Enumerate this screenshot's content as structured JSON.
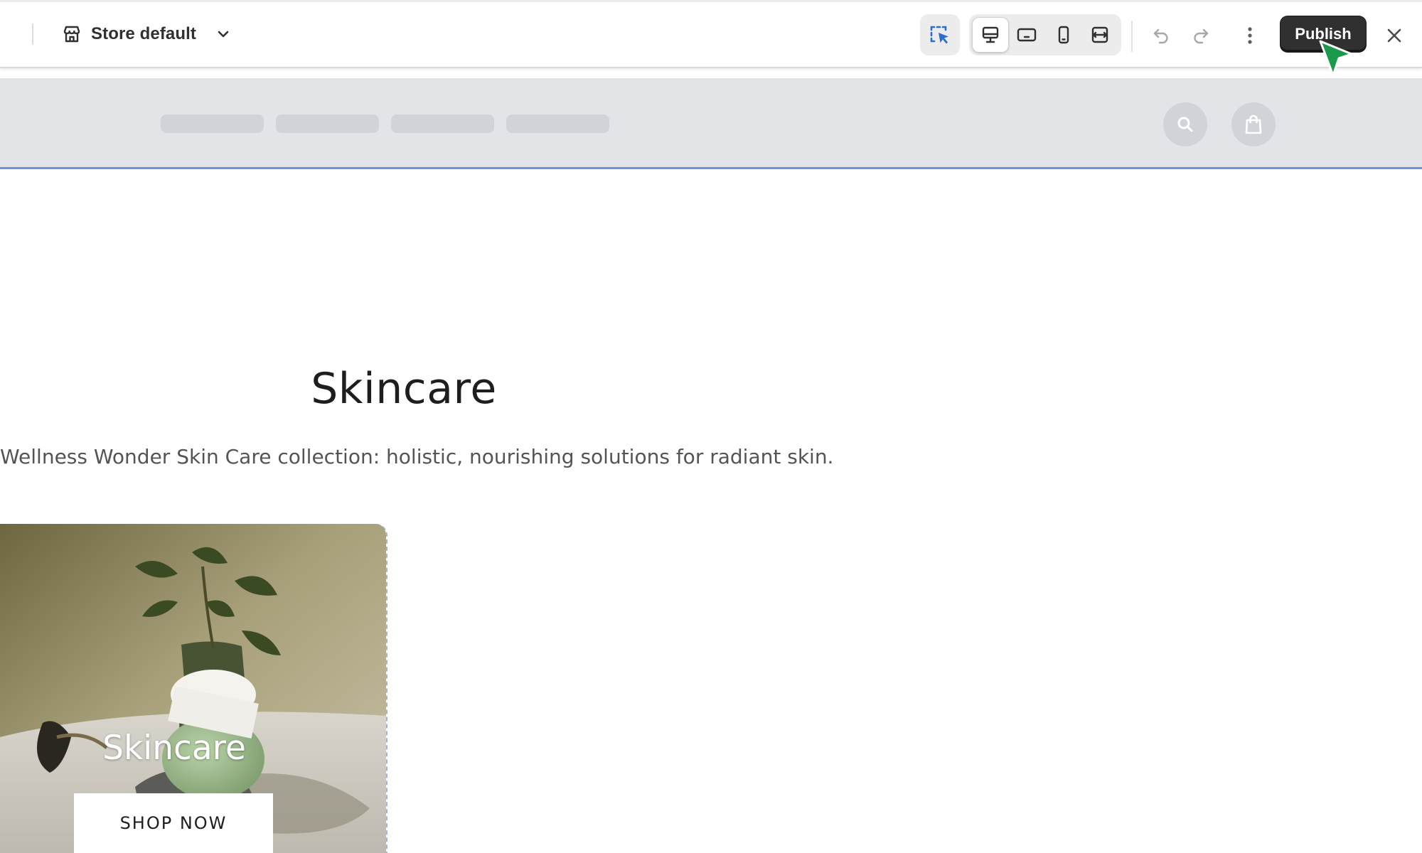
{
  "toolbar": {
    "store_selector": {
      "label": "Store default"
    },
    "select_tool": {
      "icon": "select-cursor-icon",
      "accent": "#2c6ecb"
    },
    "view_modes": [
      {
        "icon": "desktop-icon",
        "active": true
      },
      {
        "icon": "tablet-icon",
        "active": false
      },
      {
        "icon": "mobile-icon",
        "active": false
      },
      {
        "icon": "full-width-icon",
        "active": false
      }
    ],
    "undo": {
      "icon": "undo-icon"
    },
    "redo": {
      "icon": "redo-icon"
    },
    "more": {
      "icon": "more-vertical-icon"
    },
    "publish_label": "Publish",
    "close": {
      "icon": "close-icon"
    }
  },
  "preview_header": {
    "nav_placeholders": 4,
    "search_icon": "search-icon",
    "cart_icon": "shopping-bag-icon",
    "selection_outline_color": "#6b93d6"
  },
  "collection": {
    "title": "Skincare",
    "description": "Wellness Wonder Skin Care collection: holistic, nourishing solutions for radiant skin."
  },
  "card": {
    "title": "Skincare",
    "button_label": "SHOP NOW"
  },
  "colors": {
    "publish_bg": "#303030",
    "cursor": "#1a9a4a",
    "header_bg": "#e3e4e8"
  }
}
